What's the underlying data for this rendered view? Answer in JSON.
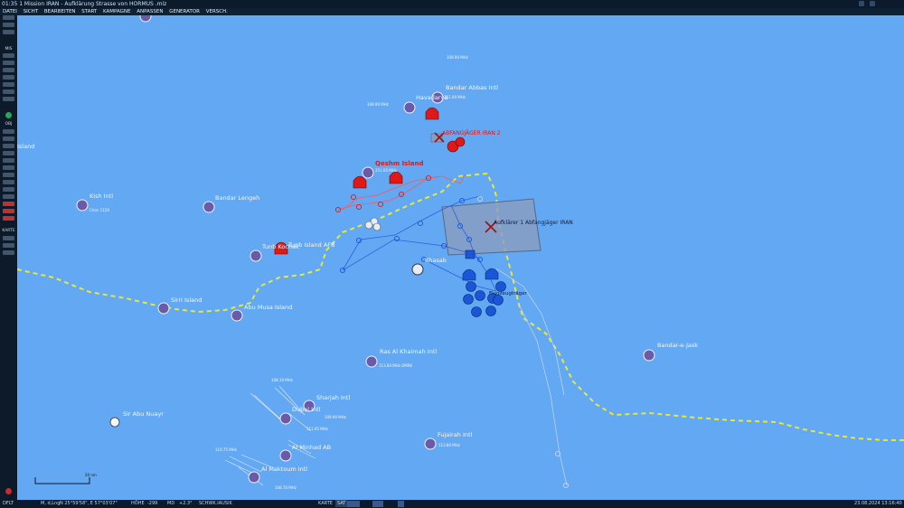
{
  "window": {
    "title": "01:35 1 Mission IRAN - Aufklärung Strasse von HORMUS .miz"
  },
  "menu": [
    "DATEI",
    "SICHT",
    "BEARBEITEN",
    "START",
    "KAMPAGNE",
    "ANPASSEN",
    "GENERATOR",
    "VERSCH."
  ],
  "sidebar": {
    "mis_label": "MIS",
    "obj_label": "OBJ",
    "karte_label": "KARTE"
  },
  "map": {
    "places": {
      "bandar_abbas": "Bandar Abbas Intl",
      "havadarya": "Havadarya",
      "qeshm": "Qeshm Island",
      "kish": "Kish Intl",
      "bandar_lengeh": "Bandar Lengeh",
      "tunb": "Tunb Island AFB",
      "tunb_kochak": "Tunb Kochak",
      "sirri": "Sirri Island",
      "abu_musa": "Abu Musa Island",
      "khasab": "Khasab",
      "ras_al_khaimah": "Ras Al Khaimah Intl",
      "bandar_e_jask": "Bandar-e-Jask",
      "sharjah": "Sharjah Intl",
      "dubai": "Dubai Intl",
      "sir_abu_nuayr": "Sir Abu Nuayr",
      "al_minhad": "Al Minhad AB",
      "al_maktoum": "Al Maktoum Intl",
      "fujairah": "Fujairah Intl",
      "island_left": "Island"
    },
    "groups": {
      "red_group": "ABFANGJÄGER IRAN 2",
      "blue_target": "Aufklärer 1 Abfangjäger IRAN",
      "carrier_group": "Flugzeugträger"
    },
    "freqs": {
      "bandar_abbas_a": "108.90 MHz",
      "bandar_abbas_b": "251.00 MHz",
      "havadarya": "108.90 MHz",
      "qeshm": "251.00 MHz",
      "kish": "Chan 112X",
      "ras_al_khaimah": "113.60 MHz OMRK",
      "fujairah": "113.80 MHz",
      "dubai_a": "108.10 MHz",
      "dubai_b": "109.90 MHz",
      "al_minhad": "110.75 MHz",
      "al_maktoum": "108.70 MHz",
      "sharjah": "111.95 MHz"
    },
    "scale_label": "20 nm"
  },
  "status": {
    "mode": "DFLT",
    "coord_label": "M, d,Lng",
    "coords": "N 25°59'58\", E 57°03'07\"",
    "hoehe_label": "HÖHE",
    "hoehe": "-299",
    "md_label": "MD",
    "md": "+2.3°",
    "difficulty": "SCHWK.IAUSIK",
    "karte_label": "KARTE",
    "karte_val": "SAT",
    "date": "23.08.2024 13:16:40"
  },
  "colors": {
    "sea": "#63a8f2",
    "border": "#e8e83a",
    "red": "#e01818",
    "blue": "#1a56d8",
    "zone": "#8a9cbf"
  }
}
